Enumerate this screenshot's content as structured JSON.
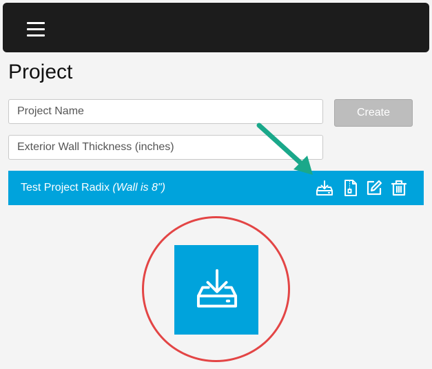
{
  "header": {
    "menu_icon": "hamburger-menu-icon"
  },
  "page": {
    "title": "Project"
  },
  "form": {
    "name_placeholder": "Project Name",
    "name_value": "",
    "wall_placeholder": "Exterior Wall Thickness (inches)",
    "wall_value": "",
    "create_label": "Create"
  },
  "project": {
    "name": "Test Project Radix ",
    "wall_note": "(Wall is 8\")",
    "actions": [
      "download-icon",
      "zip-file-icon",
      "edit-icon",
      "trash-icon"
    ]
  },
  "annotations": {
    "arrow_color": "#1aa88a",
    "circle_color": "#e34545",
    "highlighted_icon": "download-icon"
  },
  "colors": {
    "accent": "#00a3dc",
    "topbar": "#1c1c1c",
    "button_disabled": "#bdbdbd"
  }
}
